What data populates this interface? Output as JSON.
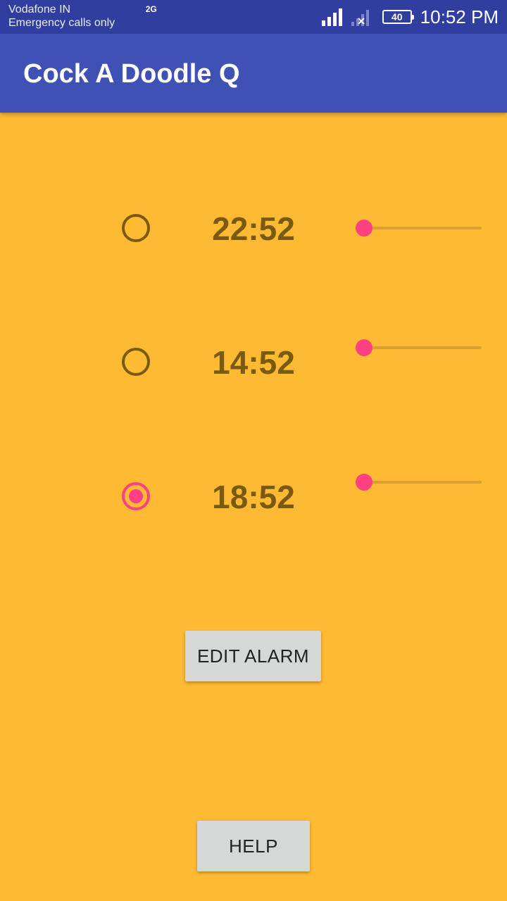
{
  "status_bar": {
    "carrier": "Vodafone IN",
    "carrier_sub": "Emergency calls only",
    "network_type": "2G",
    "battery": "40",
    "time": "10:52 PM",
    "icons": [
      "signal-icon",
      "no-signal-icon",
      "battery-icon"
    ]
  },
  "app_bar": {
    "title": "Cock A Doodle Q"
  },
  "alarms": [
    {
      "time": "22:52",
      "selected": false,
      "slider_value": 0
    },
    {
      "time": "14:52",
      "selected": false,
      "slider_value": 0
    },
    {
      "time": "18:52",
      "selected": true,
      "slider_value": 0
    }
  ],
  "buttons": {
    "edit_label": "EDIT ALARM",
    "help_label": "HELP"
  },
  "colors": {
    "background": "#FFBA33",
    "app_bar": "#3F51B5",
    "status_bar": "#303F9F",
    "accent": "#FF4081",
    "text": "#7A5A10"
  }
}
